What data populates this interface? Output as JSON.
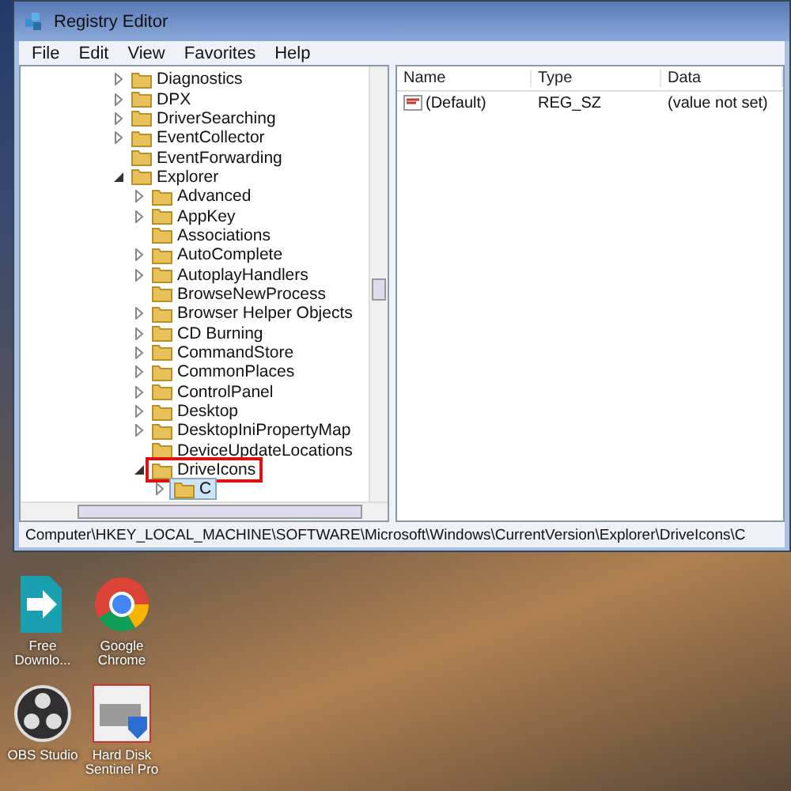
{
  "window": {
    "title": "Registry Editor"
  },
  "menu": [
    {
      "label": "File"
    },
    {
      "label": "Edit"
    },
    {
      "label": "View"
    },
    {
      "label": "Favorites"
    },
    {
      "label": "Help"
    }
  ],
  "tree": [
    {
      "label": "Diagnostics",
      "expanded": false,
      "selected": false,
      "highlighted": false
    },
    {
      "label": "DPX",
      "expanded": false,
      "selected": false,
      "highlighted": false
    },
    {
      "label": "DriverSearching",
      "expanded": false,
      "selected": false,
      "highlighted": false
    },
    {
      "label": "EventCollector",
      "expanded": false,
      "selected": false,
      "highlighted": false
    },
    {
      "label": "EventForwarding",
      "selected": false,
      "highlighted": false
    },
    {
      "label": "Explorer",
      "expanded": true,
      "selected": false,
      "highlighted": false,
      "children": [
        {
          "label": "Advanced",
          "expanded": false,
          "selected": false,
          "highlighted": false
        },
        {
          "label": "AppKey",
          "expanded": false,
          "selected": false,
          "highlighted": false
        },
        {
          "label": "Associations",
          "selected": false,
          "highlighted": false
        },
        {
          "label": "AutoComplete",
          "expanded": false,
          "selected": false,
          "highlighted": false
        },
        {
          "label": "AutoplayHandlers",
          "expanded": false,
          "selected": false,
          "highlighted": false
        },
        {
          "label": "BrowseNewProcess",
          "selected": false,
          "highlighted": false
        },
        {
          "label": "Browser Helper Objects",
          "expanded": false,
          "selected": false,
          "highlighted": false
        },
        {
          "label": "CD Burning",
          "expanded": false,
          "selected": false,
          "highlighted": false
        },
        {
          "label": "CommandStore",
          "expanded": false,
          "selected": false,
          "highlighted": false
        },
        {
          "label": "CommonPlaces",
          "expanded": false,
          "selected": false,
          "highlighted": false
        },
        {
          "label": "ControlPanel",
          "expanded": false,
          "selected": false,
          "highlighted": false
        },
        {
          "label": "Desktop",
          "expanded": false,
          "selected": false,
          "highlighted": false
        },
        {
          "label": "DesktopIniPropertyMap",
          "expanded": false,
          "selected": false,
          "highlighted": false
        },
        {
          "label": "DeviceUpdateLocations",
          "selected": false,
          "highlighted": false
        },
        {
          "label": "DriveIcons",
          "expanded": true,
          "selected": false,
          "highlighted": true,
          "children": [
            {
              "label": "C",
              "expanded": false,
              "selected": true,
              "highlighted": false
            }
          ]
        }
      ]
    }
  ],
  "values": {
    "columns": [
      "Name",
      "Type",
      "Data"
    ],
    "rows": [
      {
        "name": "(Default)",
        "type": "REG_SZ",
        "data": "(value not set)"
      }
    ]
  },
  "status_bar": "Computer\\HKEY_LOCAL_MACHINE\\SOFTWARE\\Microsoft\\Windows\\CurrentVersion\\Explorer\\DriveIcons\\C",
  "desktop_icons": [
    {
      "label": "Free Downlo...",
      "kind": "download"
    },
    {
      "label": "Google Chrome",
      "kind": "browser"
    },
    {
      "label": "OBS Studio",
      "kind": "obs"
    },
    {
      "label": "Hard Disk Sentinel Pro",
      "kind": "disk"
    }
  ]
}
